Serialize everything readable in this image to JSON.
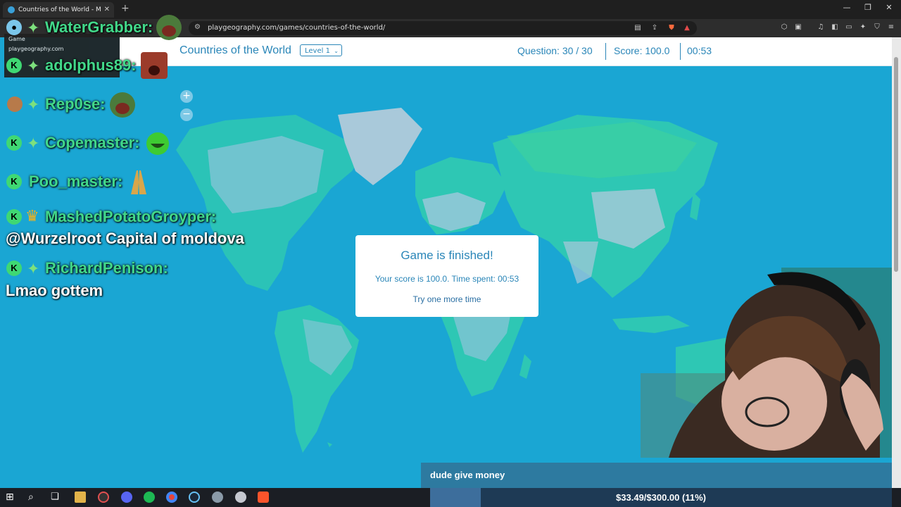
{
  "browser": {
    "tab_title": "Countries of the World - Map Qu",
    "url": "playgeography.com/games/countries-of-the-world/",
    "tooltip": {
      "line1": "Game",
      "line2": "playgeography.com"
    }
  },
  "game": {
    "title": "Countries of the World",
    "level": "Level 1",
    "question": "Question: 30 / 30",
    "score": "Score: 100.0",
    "timer": "00:53",
    "zoom_in": "+",
    "zoom_out": "−"
  },
  "modal": {
    "heading": "Game is finished!",
    "summary": "Your score is 100.0. Time spent: 00:53",
    "retry": "Try one more time"
  },
  "chat": [
    {
      "user": "WaterGrabber:",
      "message": ""
    },
    {
      "user": "adolphus89:",
      "message": ""
    },
    {
      "user": "Rep0se:",
      "message": ""
    },
    {
      "user": "Copemaster:",
      "message": ""
    },
    {
      "user": "Poo_master:",
      "message": ""
    },
    {
      "user": "MashedPotatoGroyper:",
      "message": "@Wurzelroot Capital of moldova"
    },
    {
      "user": "RichardPenison:",
      "message": "Lmao gottem"
    }
  ],
  "stream": {
    "donation_message": "dude give money",
    "goal_text": "$33.49/$300.00 (11%)",
    "goal_progress": 0.11
  },
  "colors": {
    "ocean": "#1aa6d3",
    "land": "#2ec7b4",
    "accent": "#2a86b8",
    "chat_name": "#42d88a"
  }
}
